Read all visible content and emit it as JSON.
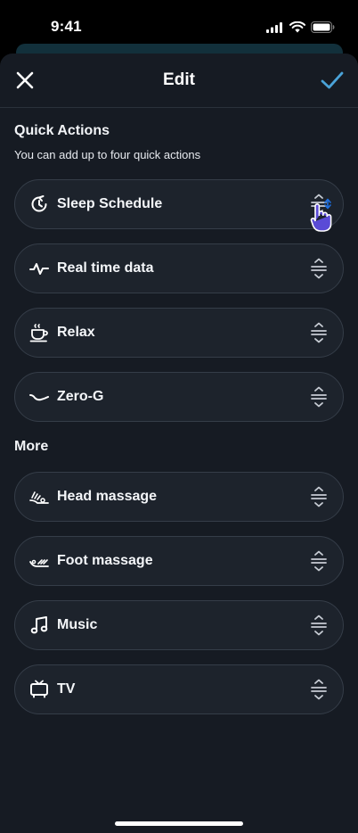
{
  "status": {
    "time": "9:41"
  },
  "nav": {
    "title": "Edit"
  },
  "quick_actions": {
    "title": "Quick Actions",
    "subtitle": "You can add up to four quick actions",
    "items": [
      {
        "label": "Sleep Schedule",
        "icon": "sleep-schedule-icon"
      },
      {
        "label": "Real time data",
        "icon": "pulse-icon"
      },
      {
        "label": "Relax",
        "icon": "coffee-cup-icon"
      },
      {
        "label": "Zero-G",
        "icon": "zero-g-curve-icon"
      }
    ]
  },
  "more": {
    "title": "More",
    "items": [
      {
        "label": "Head massage",
        "icon": "head-massage-icon"
      },
      {
        "label": "Foot massage",
        "icon": "foot-massage-icon"
      },
      {
        "label": "Music",
        "icon": "music-note-icon"
      },
      {
        "label": "TV",
        "icon": "tv-icon"
      }
    ]
  },
  "colors": {
    "accent": "#4aa3d8",
    "sheet_bg": "#161b23",
    "item_bg": "#1d232c",
    "item_border": "#353d48",
    "cursor": "#5a4bd6"
  }
}
